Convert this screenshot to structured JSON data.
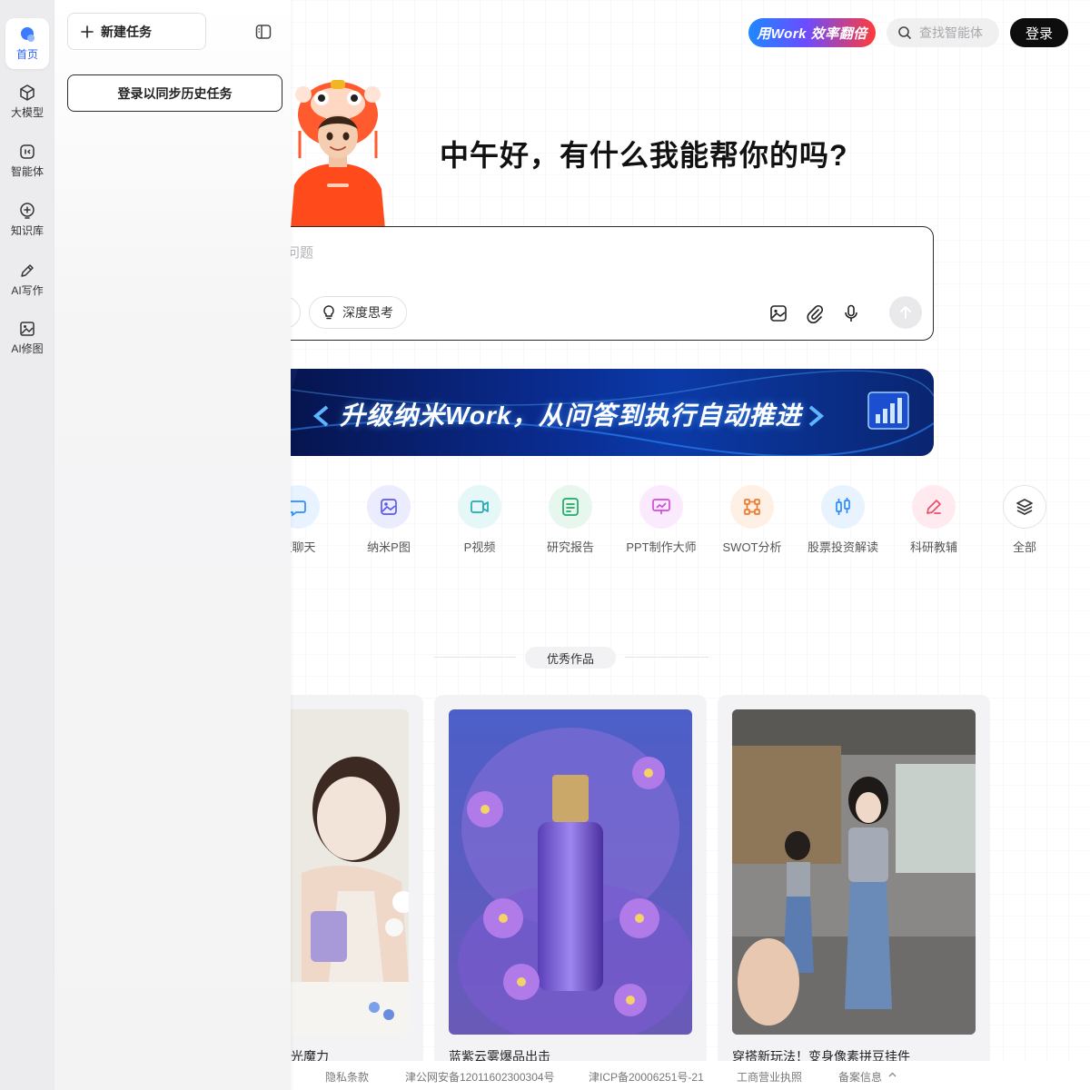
{
  "header": {
    "promo_label": "用Work 效率翻倍",
    "agent_search_placeholder": "查找智能体",
    "login_label": "登录"
  },
  "rail": {
    "items": [
      {
        "label": "首页",
        "icon": "home-icon",
        "active": true
      },
      {
        "label": "大模型",
        "icon": "cube-icon"
      },
      {
        "label": "智能体",
        "icon": "agent-icon"
      },
      {
        "label": "知识库",
        "icon": "knowledge-icon"
      },
      {
        "label": "AI写作",
        "icon": "pen-icon"
      },
      {
        "label": "AI修图",
        "icon": "image-icon"
      }
    ]
  },
  "panel": {
    "new_task_label": "新建任务",
    "sync_label": "登录以同步历史任务"
  },
  "hero": {
    "greeting": "中午好，有什么我能帮你的吗?"
  },
  "chat": {
    "placeholder": "问题",
    "deep_think_label": "深度思考"
  },
  "banner": {
    "title": "升级纳米Work，从问答到执行自动推进"
  },
  "tools": [
    {
      "label": "型聊天",
      "icon": "chat-icon",
      "color": "#2a8cff",
      "bg": "#e8f3ff"
    },
    {
      "label": "纳米P图",
      "icon": "photo-edit-icon",
      "color": "#5a5af0",
      "bg": "#ececff"
    },
    {
      "label": "P视频",
      "icon": "video-icon",
      "color": "#23a8b8",
      "bg": "#e6f7f8"
    },
    {
      "label": "研究报告",
      "icon": "report-icon",
      "color": "#1fa866",
      "bg": "#e7f7ee"
    },
    {
      "label": "PPT制作大师",
      "icon": "ppt-icon",
      "color": "#d24be0",
      "bg": "#fbeafd"
    },
    {
      "label": "SWOT分析",
      "icon": "swot-icon",
      "color": "#f07a2b",
      "bg": "#fff0e6"
    },
    {
      "label": "股票投资解读",
      "icon": "stock-icon",
      "color": "#2a8cff",
      "bg": "#e8f3ff"
    },
    {
      "label": "科研教辅",
      "icon": "research-icon",
      "color": "#f04b6a",
      "bg": "#ffeaef"
    },
    {
      "label": "全部",
      "icon": "layers-icon",
      "color": "#333333",
      "bg": "#ffffff"
    }
  ],
  "showcase": {
    "title": "优秀作品",
    "cards": [
      {
        "title": "光魔力"
      },
      {
        "title": "蓝紫云雾爆品出击"
      },
      {
        "title": "穿搭新玩法！变身像素拼豆挂件"
      }
    ]
  },
  "footer": {
    "privacy": "隐私条款",
    "police": "津公网安备12011602300304号",
    "icp": "津ICP备20006251号-21",
    "license": "工商营业执照",
    "filing": "备案信息"
  }
}
